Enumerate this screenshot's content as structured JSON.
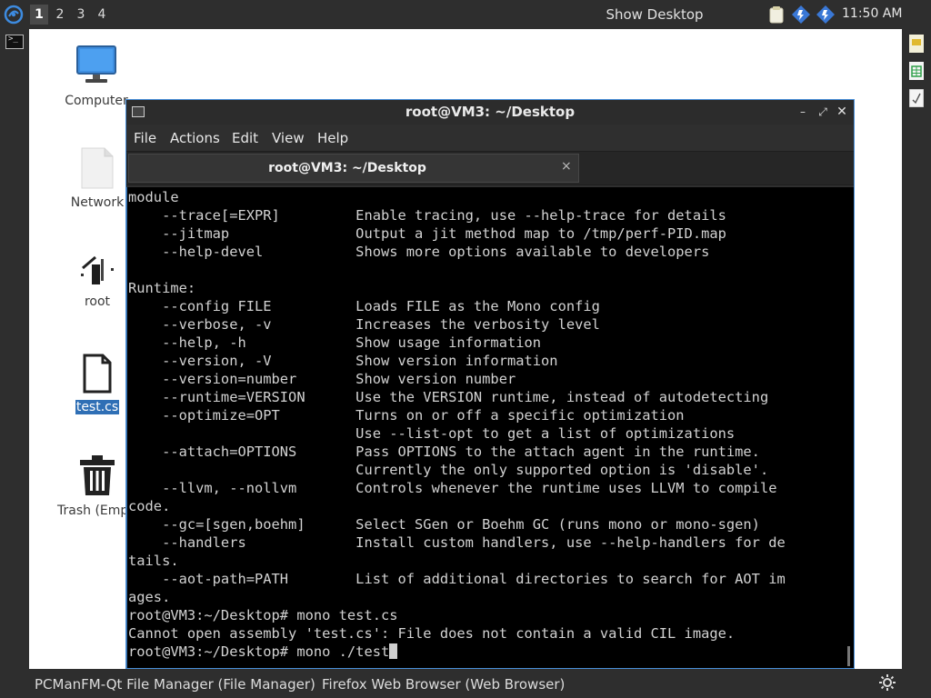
{
  "top_panel": {
    "workspaces": [
      "1",
      "2",
      "3",
      "4"
    ],
    "active_workspace": "1",
    "show_desktop": "Show Desktop",
    "clock": "11:50 AM"
  },
  "desktop_icons": [
    {
      "label": "Computer",
      "icon": "computer-icon"
    },
    {
      "label": "Network",
      "icon": "network-folder-icon"
    },
    {
      "label": "root",
      "icon": "home-folder-icon"
    },
    {
      "label": "test.cs",
      "icon": "file-icon",
      "selected": true
    },
    {
      "label": "Trash (Empty)",
      "icon": "trash-icon"
    }
  ],
  "terminal": {
    "title": "root@VM3: ~/Desktop",
    "menu": [
      "File",
      "Actions",
      "Edit",
      "View",
      "Help"
    ],
    "tab_label": "root@VM3: ~/Desktop",
    "tab_close": "×",
    "lines": [
      "module",
      "    --trace[=EXPR]         Enable tracing, use --help-trace for details",
      "    --jitmap               Output a jit method map to /tmp/perf-PID.map",
      "    --help-devel           Shows more options available to developers",
      "",
      "Runtime:",
      "    --config FILE          Loads FILE as the Mono config",
      "    --verbose, -v          Increases the verbosity level",
      "    --help, -h             Show usage information",
      "    --version, -V          Show version information",
      "    --version=number       Show version number",
      "    --runtime=VERSION      Use the VERSION runtime, instead of autodetecting",
      "    --optimize=OPT         Turns on or off a specific optimization",
      "                           Use --list-opt to get a list of optimizations",
      "    --attach=OPTIONS       Pass OPTIONS to the attach agent in the runtime.",
      "                           Currently the only supported option is 'disable'.",
      "    --llvm, --nollvm       Controls whenever the runtime uses LLVM to compile",
      "code.",
      "    --gc=[sgen,boehm]      Select SGen or Boehm GC (runs mono or mono-sgen)",
      "    --handlers             Install custom handlers, use --help-handlers for de",
      "tails.",
      "    --aot-path=PATH        List of additional directories to search for AOT im",
      "ages.",
      "root@VM3:~/Desktop# mono test.cs",
      "Cannot open assembly 'test.cs': File does not contain a valid CIL image.",
      "root@VM3:~/Desktop# mono ./test"
    ]
  },
  "taskbar": {
    "tasks": [
      "PCManFM-Qt File Manager (File Manager)",
      "Firefox Web Browser (Web Browser)"
    ]
  },
  "colors": {
    "accent": "#4a90d9",
    "panel": "#2e2e2e",
    "terminal_bg": "#000000",
    "terminal_fg": "#d2d2d2",
    "selection": "#2f6fb5"
  }
}
